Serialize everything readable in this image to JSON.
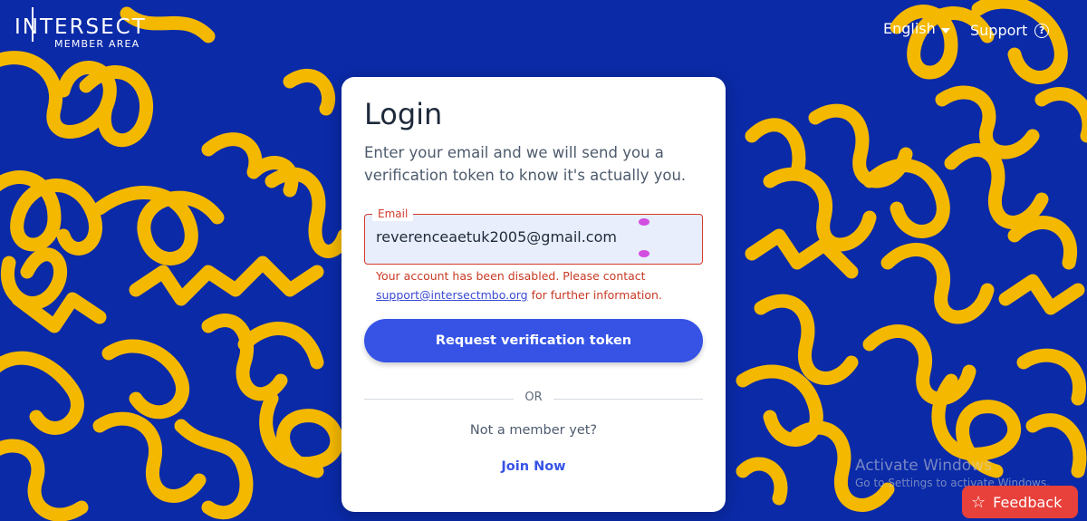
{
  "header": {
    "logo_main": "INTERSECT",
    "logo_sub": "MEMBER AREA",
    "language": "English",
    "support": "Support",
    "support_icon": "help-circle-icon"
  },
  "login": {
    "title": "Login",
    "subtitle": "Enter your email and we will send you a verification token to know it's actually you.",
    "email_label": "Email",
    "email_value": "reverenceaetuk2005@gmail.com",
    "error_text_before": "Your account has been disabled. Please contact ",
    "error_link": "support@intersectmbo.org",
    "error_text_after": " for further information.",
    "request_button": "Request verification token",
    "divider_text": "OR",
    "not_member": "Not a member yet?",
    "join_link": "Join Now"
  },
  "watermark": {
    "line1": "Activate Windows",
    "line2": "Go to Settings to activate Windows."
  },
  "feedback": {
    "label": "Feedback",
    "icon": "star-icon"
  },
  "colors": {
    "background": "#0a2aa8",
    "squiggle": "#f5b800",
    "primary_button": "#3653e6",
    "error": "#c83a24",
    "feedback": "#e8403a"
  }
}
